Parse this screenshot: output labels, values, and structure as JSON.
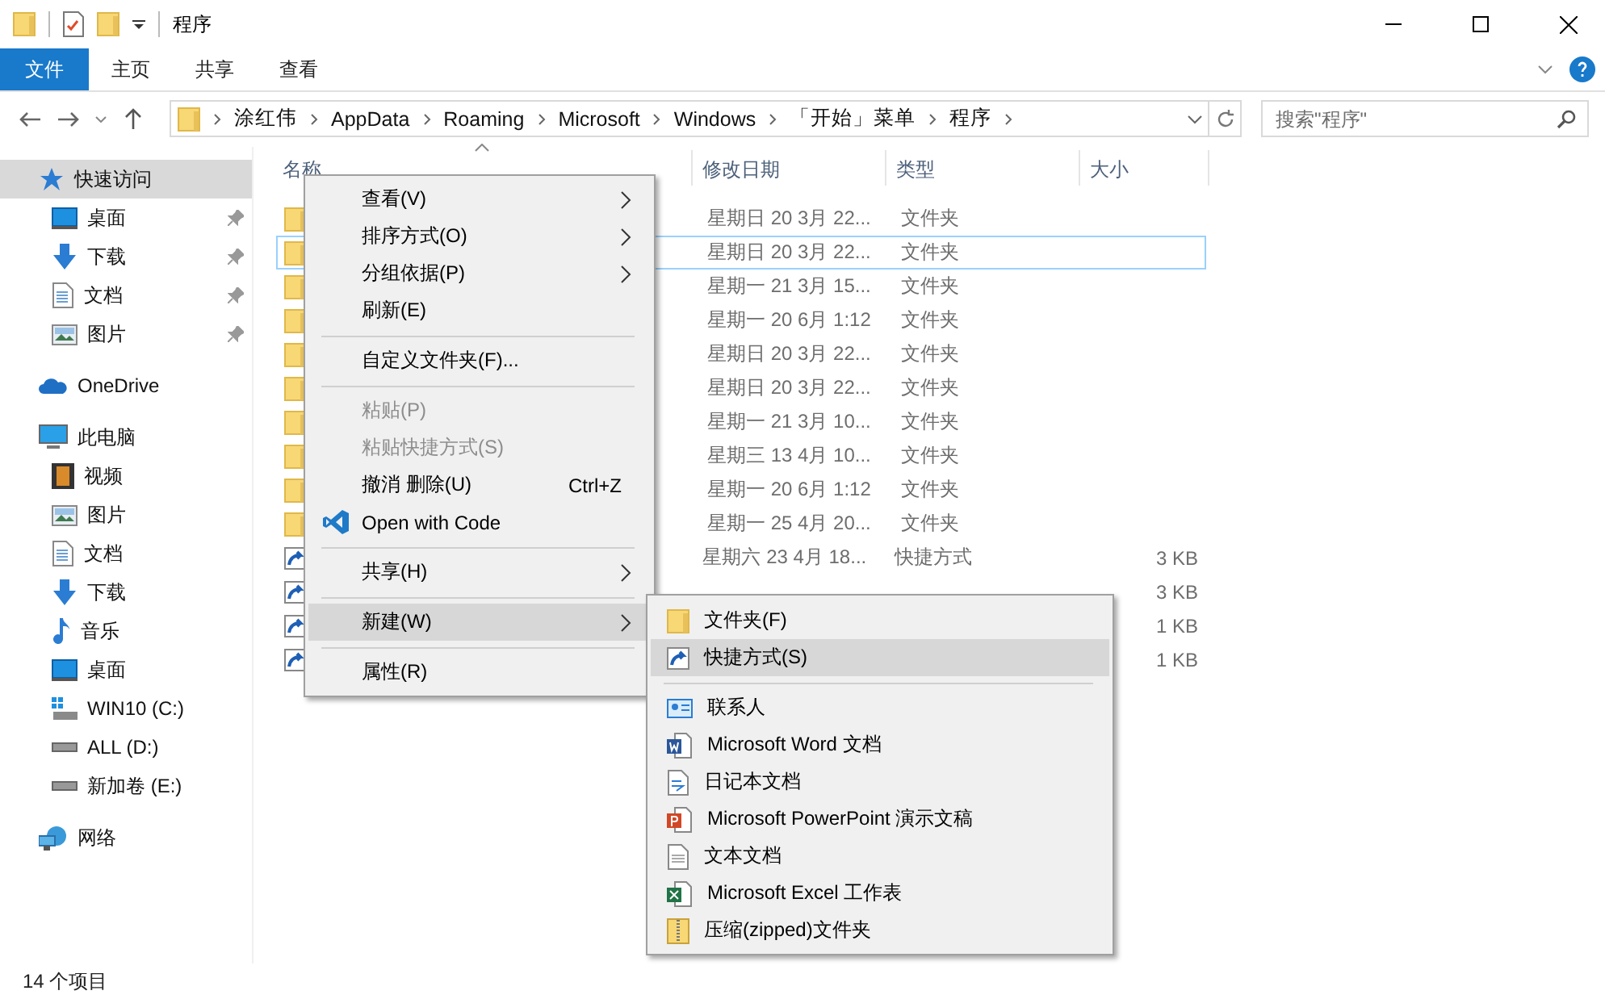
{
  "window": {
    "title": "程序"
  },
  "ribbon": {
    "tabs": [
      {
        "label": "文件",
        "kind": "file"
      },
      {
        "label": "主页",
        "kind": "tab"
      },
      {
        "label": "共享",
        "kind": "tab"
      },
      {
        "label": "查看",
        "kind": "tab"
      }
    ]
  },
  "address": {
    "crumbs": [
      "涂红伟",
      "AppData",
      "Roaming",
      "Microsoft",
      "Windows",
      "「开始」菜单",
      "程序"
    ]
  },
  "search": {
    "placeholder": "搜索\"程序\""
  },
  "sidebar": {
    "items": [
      {
        "label": "快速访问",
        "kind": "star",
        "selected": true,
        "children": [
          {
            "label": "桌面",
            "kind": "desktop",
            "selected": false,
            "pinned": true
          },
          {
            "label": "下载",
            "kind": "download",
            "selected": false,
            "pinned": true
          },
          {
            "label": "文档",
            "kind": "document",
            "selected": false,
            "pinned": true
          },
          {
            "label": "图片",
            "kind": "picture",
            "selected": false,
            "pinned": true
          }
        ]
      },
      {
        "label": "OneDrive",
        "kind": "cloud",
        "selected": false
      },
      {
        "label": "此电脑",
        "kind": "computer",
        "selected": false,
        "children": [
          {
            "label": "视频",
            "kind": "video",
            "selected": false
          },
          {
            "label": "图片",
            "kind": "picture",
            "selected": false
          },
          {
            "label": "文档",
            "kind": "document",
            "selected": false
          },
          {
            "label": "下载",
            "kind": "download",
            "selected": false
          },
          {
            "label": "音乐",
            "kind": "music",
            "selected": false
          },
          {
            "label": "桌面",
            "kind": "desktop",
            "selected": false
          },
          {
            "label": "WIN10 (C:)",
            "kind": "windrive",
            "selected": false
          },
          {
            "label": "ALL (D:)",
            "kind": "drive",
            "selected": false
          },
          {
            "label": "新加卷 (E:)",
            "kind": "drive",
            "selected": false
          }
        ]
      },
      {
        "label": "网络",
        "kind": "network",
        "selected": false
      }
    ]
  },
  "table": {
    "columns": [
      {
        "label": "名称",
        "sorted": true
      },
      {
        "label": "修改日期"
      },
      {
        "label": "类型"
      },
      {
        "label": "大小"
      }
    ],
    "rows": [
      {
        "kind": "folder",
        "date": "星期日 20 3月 22...",
        "type": "文件夹",
        "selected": false
      },
      {
        "kind": "folder",
        "date": "星期日 20 3月 22...",
        "type": "文件夹",
        "selected": true
      },
      {
        "kind": "folder",
        "date": "星期一 21 3月 15...",
        "type": "文件夹",
        "selected": false
      },
      {
        "kind": "folder",
        "date": "星期一 20 6月 1:12",
        "type": "文件夹",
        "selected": false
      },
      {
        "kind": "folder",
        "date": "星期日 20 3月 22...",
        "type": "文件夹",
        "selected": false
      },
      {
        "kind": "folder",
        "date": "星期日 20 3月 22...",
        "type": "文件夹",
        "selected": false
      },
      {
        "kind": "folder",
        "date": "星期一 21 3月 10...",
        "type": "文件夹",
        "selected": false
      },
      {
        "kind": "folder",
        "date": "星期三 13 4月 10...",
        "type": "文件夹",
        "selected": false
      },
      {
        "kind": "folder",
        "date": "星期一 20 6月 1:12",
        "type": "文件夹",
        "selected": false
      },
      {
        "kind": "folder",
        "date": "星期一 25 4月 20...",
        "type": "文件夹",
        "selected": false
      },
      {
        "kind": "shortcut",
        "date": "星期六 23 4月 18...",
        "type": "快捷方式",
        "size": "3 KB",
        "selected": false
      },
      {
        "kind": "shortcut",
        "size": "3 KB",
        "selected": false
      },
      {
        "kind": "shortcut",
        "size": "1 KB",
        "selected": false
      },
      {
        "kind": "shortcut",
        "size": "1 KB",
        "selected": false
      }
    ]
  },
  "context_menu": {
    "groups": [
      [
        {
          "label": "查看(V)",
          "kind": "plain",
          "submenu": true,
          "disabled": false,
          "selected": false
        },
        {
          "label": "排序方式(O)",
          "kind": "plain",
          "submenu": true,
          "disabled": false,
          "selected": false
        },
        {
          "label": "分组依据(P)",
          "kind": "plain",
          "submenu": true,
          "disabled": false,
          "selected": false
        },
        {
          "label": "刷新(E)",
          "kind": "plain",
          "submenu": false,
          "disabled": false,
          "selected": false
        }
      ],
      [
        {
          "label": "自定义文件夹(F)...",
          "kind": "plain",
          "submenu": false,
          "disabled": false,
          "selected": false
        }
      ],
      [
        {
          "label": "粘贴(P)",
          "kind": "plain",
          "submenu": false,
          "disabled": true,
          "selected": false
        },
        {
          "label": "粘贴快捷方式(S)",
          "kind": "plain",
          "submenu": false,
          "disabled": true,
          "selected": false
        },
        {
          "label": "撤消 删除(U)",
          "kind": "plain",
          "submenu": false,
          "disabled": false,
          "selected": false,
          "shortcut": "Ctrl+Z"
        },
        {
          "label": "Open with Code",
          "kind": "app",
          "submenu": false,
          "disabled": false,
          "selected": false
        }
      ],
      [
        {
          "label": "共享(H)",
          "kind": "plain",
          "submenu": true,
          "disabled": false,
          "selected": false
        }
      ],
      [
        {
          "label": "新建(W)",
          "kind": "plain",
          "submenu": true,
          "disabled": false,
          "selected": true
        }
      ],
      [
        {
          "label": "属性(R)",
          "kind": "plain",
          "submenu": false,
          "disabled": false,
          "selected": false
        }
      ]
    ]
  },
  "new_submenu": {
    "groups": [
      [
        {
          "label": "文件夹(F)",
          "kind": "folder",
          "selected": false
        },
        {
          "label": "快捷方式(S)",
          "kind": "shortcut",
          "selected": true
        }
      ],
      [
        {
          "label": "联系人",
          "kind": "contact",
          "selected": false
        },
        {
          "label": "Microsoft Word 文档",
          "kind": "word",
          "selected": false
        },
        {
          "label": "日记本文档",
          "kind": "journal",
          "selected": false
        },
        {
          "label": "Microsoft PowerPoint 演示文稿",
          "kind": "powerpoint",
          "selected": false
        },
        {
          "label": "文本文档",
          "kind": "text",
          "selected": false
        },
        {
          "label": "Microsoft Excel 工作表",
          "kind": "excel",
          "selected": false
        },
        {
          "label": "压缩(zipped)文件夹",
          "kind": "zip",
          "selected": false
        }
      ]
    ]
  },
  "status_bar": {
    "count": "14 个项目"
  }
}
